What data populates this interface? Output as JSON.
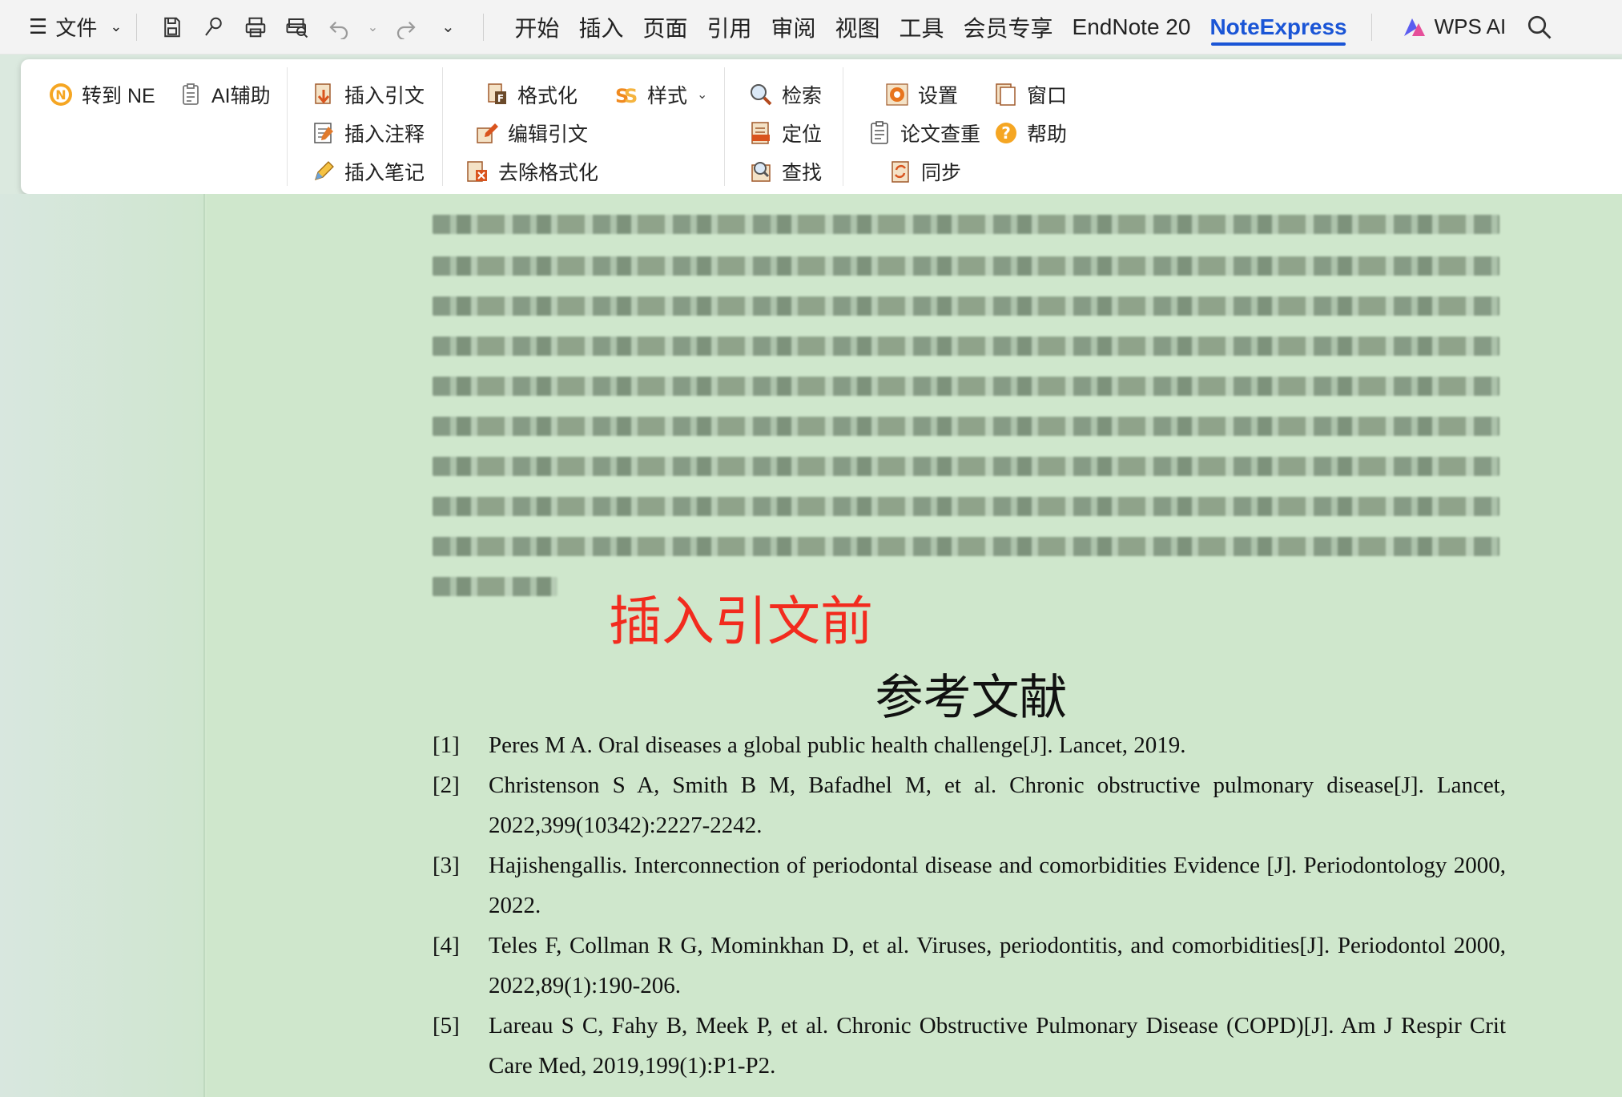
{
  "menubar": {
    "file_label": "文件",
    "tabs": [
      "开始",
      "插入",
      "页面",
      "引用",
      "审阅",
      "视图",
      "工具",
      "会员专享",
      "EndNote 20",
      "NoteExpress"
    ],
    "active_tab": "NoteExpress",
    "wps_ai_label": "WPS AI"
  },
  "ribbon": {
    "to_ne": "转到 NE",
    "ai_assist": "AI辅助",
    "insert_citation": "插入引文",
    "insert_note": "插入注释",
    "insert_memo": "插入笔记",
    "format": "格式化",
    "style": "样式",
    "edit_citation": "编辑引文",
    "remove_format": "去除格式化",
    "search": "检索",
    "locate": "定位",
    "find": "查找",
    "settings": "设置",
    "window": "窗口",
    "plagiarism": "论文查重",
    "help": "帮助",
    "sync": "同步"
  },
  "document": {
    "annotation": "插入引文前",
    "references_title": "参考文献",
    "references": [
      {
        "num": "[1]",
        "text": "Peres M A. Oral diseases    a global public health challenge[J]. Lancet, 2019."
      },
      {
        "num": "[2]",
        "text": "Christenson S A, Smith B M, Bafadhel M, et al. Chronic obstructive pulmonary disease[J]. Lancet, 2022,399(10342):2227-2242."
      },
      {
        "num": "[3]",
        "text": "Hajishengallis. Interconnection of periodontal disease and comorbidities    Evidence [J]. Periodontology 2000, 2022."
      },
      {
        "num": "[4]",
        "text": "Teles F, Collman R G, Mominkhan D, et al. Viruses, periodontitis, and comorbidities[J]. Periodontol 2000, 2022,89(1):190-206."
      },
      {
        "num": "[5]",
        "text": "Lareau S C, Fahy B, Meek P, et al. Chronic Obstructive Pulmonary Disease (COPD)[J]. Am J Respir Crit Care Med, 2019,199(1):P1-P2."
      }
    ]
  },
  "colors": {
    "accent": "#1a55d6",
    "annotation": "#f22b1e",
    "doc_background": "#cfe7cc"
  }
}
